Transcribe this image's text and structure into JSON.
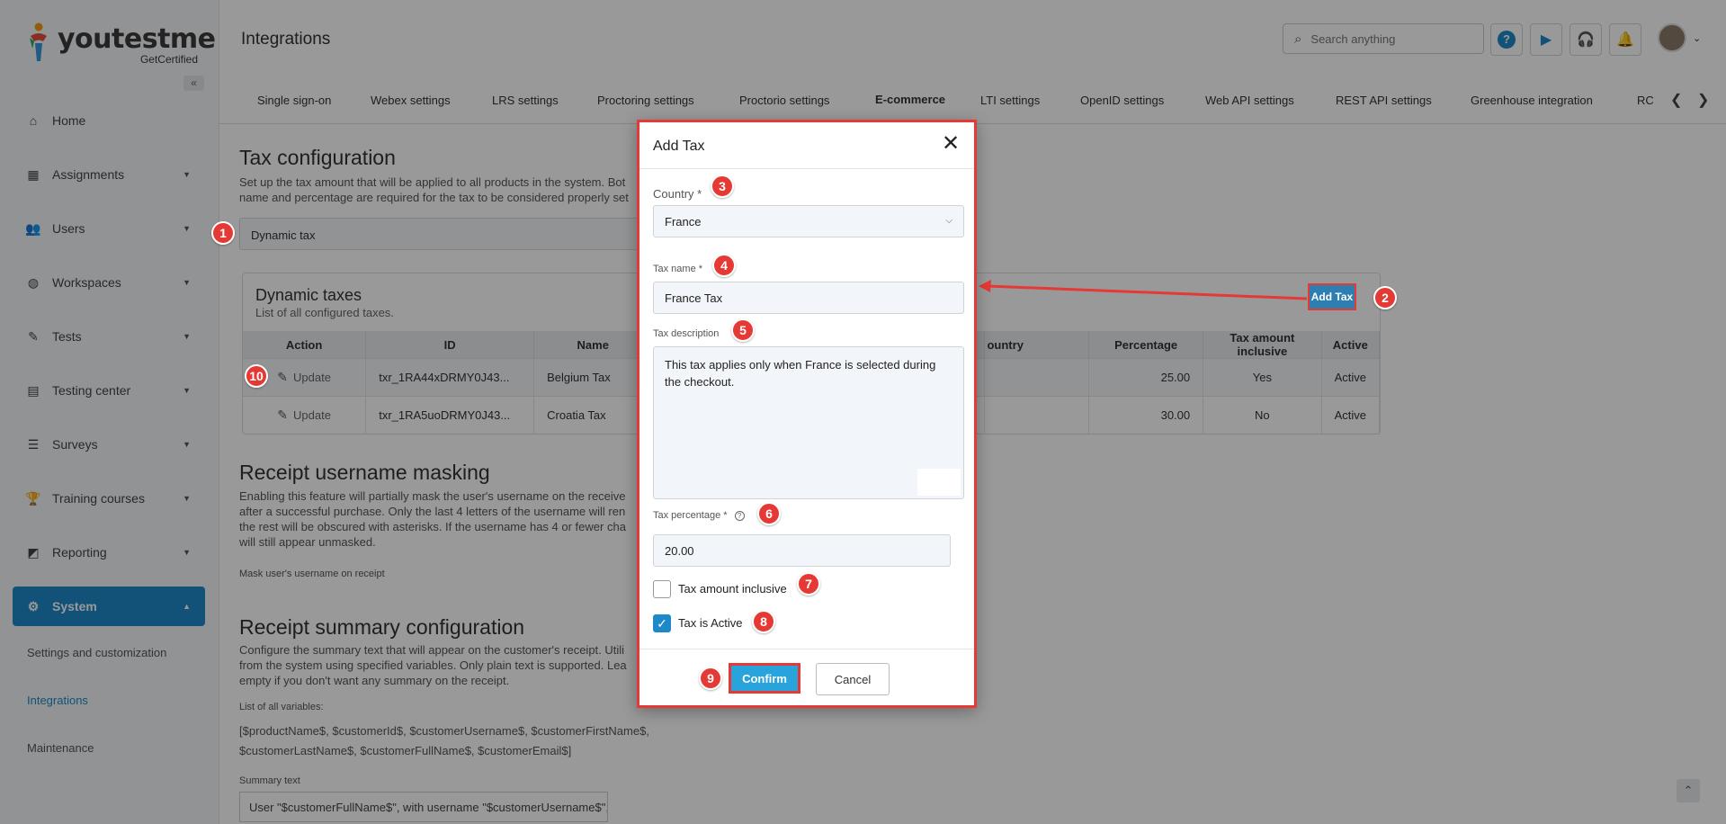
{
  "logo": {
    "text": "youtestme",
    "sub": "GetCertified"
  },
  "sidebar": {
    "collapse": "«",
    "items": [
      {
        "label": "Home",
        "icon": "home-icon",
        "glyph": "⌂",
        "caret": ""
      },
      {
        "label": "Assignments",
        "icon": "assignments-icon",
        "glyph": "▦",
        "caret": "▼"
      },
      {
        "label": "Users",
        "icon": "users-icon",
        "glyph": "👥",
        "caret": "▼"
      },
      {
        "label": "Workspaces",
        "icon": "globe-icon",
        "glyph": "◍",
        "caret": "▼"
      },
      {
        "label": "Tests",
        "icon": "tests-icon",
        "glyph": "✎",
        "caret": "▼"
      },
      {
        "label": "Testing center",
        "icon": "testing-center-icon",
        "glyph": "▤",
        "caret": "▼"
      },
      {
        "label": "Surveys",
        "icon": "surveys-icon",
        "glyph": "☰",
        "caret": "▼"
      },
      {
        "label": "Training courses",
        "icon": "trophy-icon",
        "glyph": "🏆",
        "caret": "▼"
      },
      {
        "label": "Reporting",
        "icon": "reporting-icon",
        "glyph": "◩",
        "caret": "▼"
      },
      {
        "label": "System",
        "icon": "gear-icon",
        "glyph": "⚙",
        "caret": "▲"
      }
    ],
    "subitems": [
      "Settings and customization",
      "Integrations",
      "Maintenance"
    ]
  },
  "topbar": {
    "title": "Integrations",
    "search_placeholder": "Search anything",
    "icons": [
      {
        "name": "help-icon",
        "glyph": "?"
      },
      {
        "name": "play-icon",
        "glyph": "▶"
      },
      {
        "name": "headset-icon",
        "glyph": "🎧"
      },
      {
        "name": "bell-icon",
        "glyph": "🔔"
      }
    ],
    "avatar_caret": "⌄"
  },
  "tabs": [
    {
      "label": "Single sign-on"
    },
    {
      "label": "Webex settings"
    },
    {
      "label": "LRS settings"
    },
    {
      "label": "Proctoring settings"
    },
    {
      "label": "Proctorio settings"
    },
    {
      "label": "E-commerce"
    },
    {
      "label": "LTI settings"
    },
    {
      "label": "OpenID settings"
    },
    {
      "label": "Web API settings"
    },
    {
      "label": "REST API settings"
    },
    {
      "label": "Greenhouse integration"
    },
    {
      "label": "RCI"
    }
  ],
  "content": {
    "tax_title": "Tax configuration",
    "tax_desc_1": "Set up the tax amount that will be applied to all products in the system. Bot",
    "tax_desc_2": "name and percentage are required for the tax to be considered properly set",
    "tax_type": "Dynamic tax",
    "panel_title": "Dynamic taxes",
    "panel_sub": "List of all configured taxes.",
    "add_tax": "Add Tax",
    "columns": [
      "Action",
      "ID",
      "Name",
      "",
      "ountry",
      "Percentage",
      "Tax amount inclusive",
      "Active"
    ],
    "rows": [
      {
        "action": "Update",
        "id": "txr_1RA44xDRMY0J43...",
        "name": "Belgium Tax",
        "percentage": "25.00",
        "inclusive": "Yes",
        "active": "Active"
      },
      {
        "action": "Update",
        "id": "txr_1RA5uoDRMY0J43...",
        "name": "Croatia Tax",
        "percentage": "30.00",
        "inclusive": "No",
        "active": "Active"
      }
    ],
    "masking_title": "Receipt username masking",
    "masking_desc_1": "Enabling this feature will partially mask the user's username on the receive",
    "masking_desc_2": "after a successful purchase. Only the last 4 letters of the username will ren",
    "masking_desc_3": "the rest will be obscured with asterisks. If the username has 4 or fewer cha",
    "masking_desc_4": "will still appear unmasked.",
    "masking_label": "Mask user's username on receipt",
    "summary_title": "Receipt summary configuration",
    "summary_desc_1": "Configure the summary text that will appear on the customer's receipt. Utili",
    "summary_desc_2": "from the system using specified variables. Only plain text is supported. Lea",
    "summary_desc_3": "empty if you don't want any summary on the receipt.",
    "variables_label": "List of all variables:",
    "variables_1": "[$productName$, $customerId$, $customerUsername$, $customerFirstName$,",
    "variables_2": "$customerLastName$, $customerFullName$, $customerEmail$]",
    "summary_label": "Summary text",
    "summary_value": "User \"$customerFullName$\", with username \"$customerUsername$\", and email a",
    "scroll_top": "⌃"
  },
  "modal": {
    "title": "Add Tax",
    "close": "✕",
    "country_label": "Country",
    "country_value": "France",
    "tax_name_label": "Tax name",
    "tax_name_value": "France Tax",
    "tax_desc_label": "Tax description",
    "tax_desc_value": "This tax applies only when France is selected during the checkout.",
    "tax_pct_label": "Tax percentage",
    "tax_pct_value": "20.00",
    "inclusive_label": "Tax amount inclusive",
    "inclusive_checked": false,
    "active_label": "Tax is Active",
    "active_checked": true,
    "confirm": "Confirm",
    "cancel": "Cancel",
    "required_mark": "*",
    "help": "?",
    "check": "✓",
    "caret": "⌵"
  },
  "callouts": [
    "1",
    "2",
    "3",
    "4",
    "5",
    "6",
    "7",
    "8",
    "9",
    "10"
  ],
  "colors": {
    "accent": "#1e88c9",
    "callout": "#e53935",
    "confirm": "#29a3dc"
  }
}
